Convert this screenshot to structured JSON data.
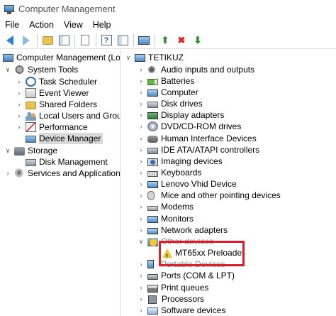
{
  "window": {
    "title": "Computer Management"
  },
  "menu": [
    "File",
    "Action",
    "View",
    "Help"
  ],
  "toolbar": {
    "icons": [
      "back-arrow-icon",
      "forward-arrow-icon",
      "up-folder-icon",
      "show-hide-tree-icon",
      "properties-icon",
      "help-icon",
      "show-pane-icon",
      "scan-hardware-icon",
      "update-driver-icon",
      "uninstall-icon",
      "disable-device-icon"
    ]
  },
  "left_tree": {
    "root": "Computer Management (Local",
    "system_tools": "System Tools",
    "task_scheduler": "Task Scheduler",
    "event_viewer": "Event Viewer",
    "shared_folders": "Shared Folders",
    "local_users": "Local Users and Groups",
    "performance": "Performance",
    "device_manager": "Device Manager",
    "storage": "Storage",
    "disk_management": "Disk Management",
    "services": "Services and Applications"
  },
  "device_tree": {
    "computer_name": "TETIKUZ",
    "categories": {
      "audio": "Audio inputs and outputs",
      "batteries": "Batteries",
      "computer": "Computer",
      "disk_drives": "Disk drives",
      "display": "Display adapters",
      "dvd": "DVD/CD-ROM drives",
      "hid": "Human Interface Devices",
      "ide": "IDE ATA/ATAPI controllers",
      "imaging": "Imaging devices",
      "keyboards": "Keyboards",
      "lenovo": "Lenovo Vhid Device",
      "mice": "Mice and other pointing devices",
      "modems": "Modems",
      "monitors": "Monitors",
      "network": "Network adapters",
      "other": "Other devices",
      "other_child": "MT65xx Preloader",
      "portable": "Portable Devices",
      "ports": "Ports (COM & LPT)",
      "print_queues": "Print queues",
      "processors": "Processors",
      "software": "Software devices"
    }
  },
  "colors": {
    "highlight_box": "#d7202c",
    "selection": "#d9d9d9"
  }
}
